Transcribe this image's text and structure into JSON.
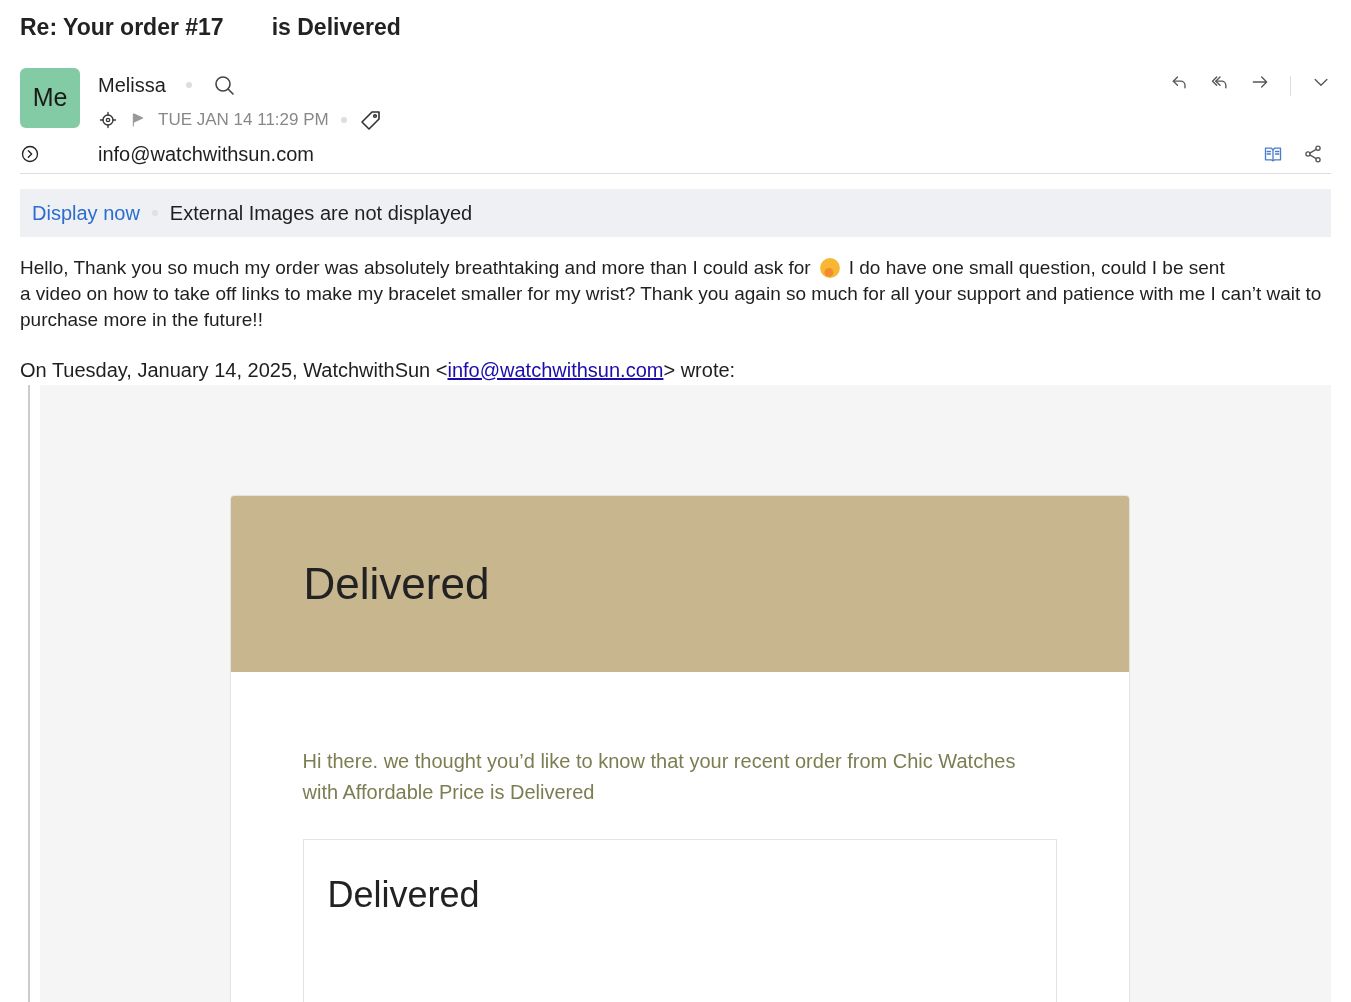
{
  "subject": {
    "part_1": "Re: Your order #17",
    "part_2": "is Delivered"
  },
  "sender": {
    "avatar": "Me",
    "name": "Melissa",
    "date": "TUE JAN 14 11:29 PM",
    "email": "info@watchwithsun.com"
  },
  "images_banner": {
    "link": "Display now",
    "message": "External Images are not displayed"
  },
  "body": {
    "before_emoji": "Hello, Thank you so much my order was absolutely breathtaking and more than I could ask for",
    "after_emoji": "I do have one small question, could I be sent",
    "continuation": "a video on how to take off links to make my bracelet smaller for my wrist? Thank you again so much for all your support and patience with me I can’t wait to purchase more in the future!!"
  },
  "quote_intro": {
    "before": "On Tuesday, January 14, 2025, WatchwithSun <",
    "link": "info@watchwithsun.com",
    "after": "> wrote:"
  },
  "quoted": {
    "header_title": "Delivered",
    "message": "Hi there. we thought you’d like to know that your recent order from Chic Watches with Affordable Price is Delivered",
    "inner_title": "Delivered"
  }
}
